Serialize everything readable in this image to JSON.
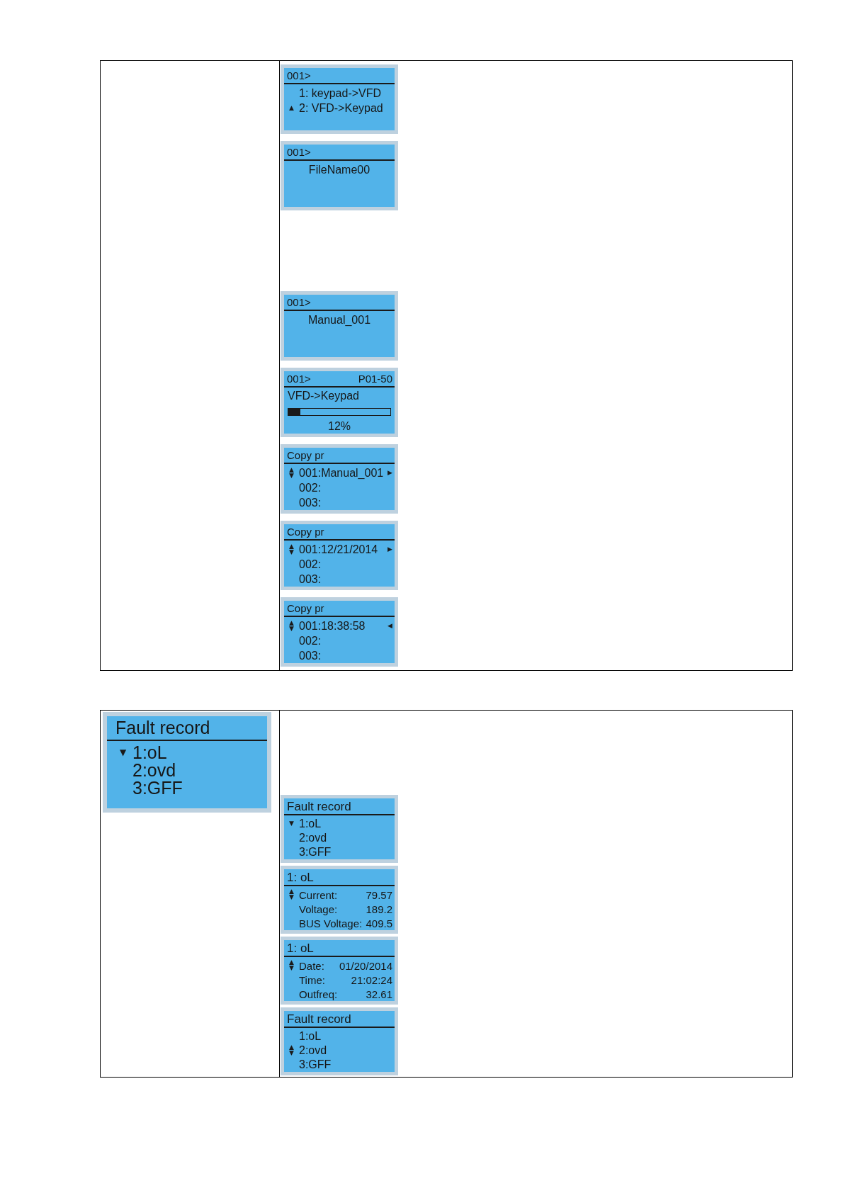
{
  "tables": [
    {
      "groups": [
        {
          "screens": [
            {
              "kind": "menu",
              "header": "001>",
              "cursor": "▲",
              "rows": [
                {
                  "text": "1: keypad->VFD",
                  "selected": false
                },
                {
                  "text": "2: VFD->Keypad",
                  "selected": true
                }
              ]
            },
            {
              "kind": "file",
              "header": "001>",
              "name": "FileName00"
            }
          ]
        },
        {
          "screens": [
            {
              "kind": "file",
              "header": "001>",
              "name": "Manual_001"
            },
            {
              "kind": "progress",
              "header": "001>",
              "header_right": "P01-50",
              "text": "VFD->Keypad",
              "level": 0.12,
              "reading": "12%"
            },
            {
              "kind": "menu",
              "header": "Copy pr",
              "cursor": "▲▼",
              "rows": [
                {
                  "text": "001:Manual_001",
                  "selected": true,
                  "arrow": "▶"
                },
                {
                  "text": "002:",
                  "selected": false
                },
                {
                  "text": "003:",
                  "selected": false
                }
              ]
            },
            {
              "kind": "menu",
              "header": "Copy pr",
              "cursor": "▲▼",
              "rows": [
                {
                  "text": "001:12/21/2014",
                  "selected": true,
                  "arrow": "▶"
                },
                {
                  "text": "002:",
                  "selected": false
                },
                {
                  "text": "003:",
                  "selected": false
                }
              ]
            },
            {
              "kind": "menu",
              "header": "Copy pr",
              "cursor": "▲▼",
              "rows": [
                {
                  "text": "001:18:38:58",
                  "selected": true,
                  "arrow": "◀"
                },
                {
                  "text": "002:",
                  "selected": false
                },
                {
                  "text": "003:",
                  "selected": false
                }
              ]
            }
          ]
        }
      ]
    },
    {
      "left_screens": [
        {
          "kind": "menu",
          "header": "Fault record",
          "cursor": "▼",
          "rows": [
            {
              "text": "1:oL",
              "selected": true
            },
            {
              "text": "2:ovd",
              "selected": false
            },
            {
              "text": "3:GFF",
              "selected": false
            }
          ]
        }
      ],
      "groups": [
        {
          "screens": [
            {
              "kind": "menu",
              "header": "Fault record",
              "cursor": "▼",
              "rows": [
                {
                  "text": "1:oL",
                  "selected": true
                },
                {
                  "text": "2:ovd",
                  "selected": false
                },
                {
                  "text": "3:GFF",
                  "selected": false
                }
              ]
            },
            {
              "kind": "detail",
              "header": "1: oL",
              "cursor": "▲▼",
              "rows": [
                {
                  "label": "Current:",
                  "value": "79.57",
                  "selected": true
                },
                {
                  "label": "Voltage:",
                  "value": "189.2",
                  "selected": false
                },
                {
                  "label": "BUS Voltage:",
                  "value": "409.5",
                  "selected": false
                }
              ]
            },
            {
              "kind": "detail",
              "header": "1: oL",
              "cursor": "▲▼",
              "rows": [
                {
                  "label": "Date:",
                  "value": "01/20/2014",
                  "selected": true
                },
                {
                  "label": "Time:",
                  "value": "21:02:24",
                  "selected": false
                },
                {
                  "label": "Outfreq:",
                  "value": "32.61",
                  "selected": false
                }
              ]
            },
            {
              "kind": "menu",
              "header": "Fault record",
              "cursor": "▲▼",
              "rows": [
                {
                  "text": "1:oL",
                  "selected": false
                },
                {
                  "text": "2:ovd",
                  "selected": true
                },
                {
                  "text": "3:GFF",
                  "selected": false
                }
              ]
            }
          ]
        }
      ]
    }
  ]
}
